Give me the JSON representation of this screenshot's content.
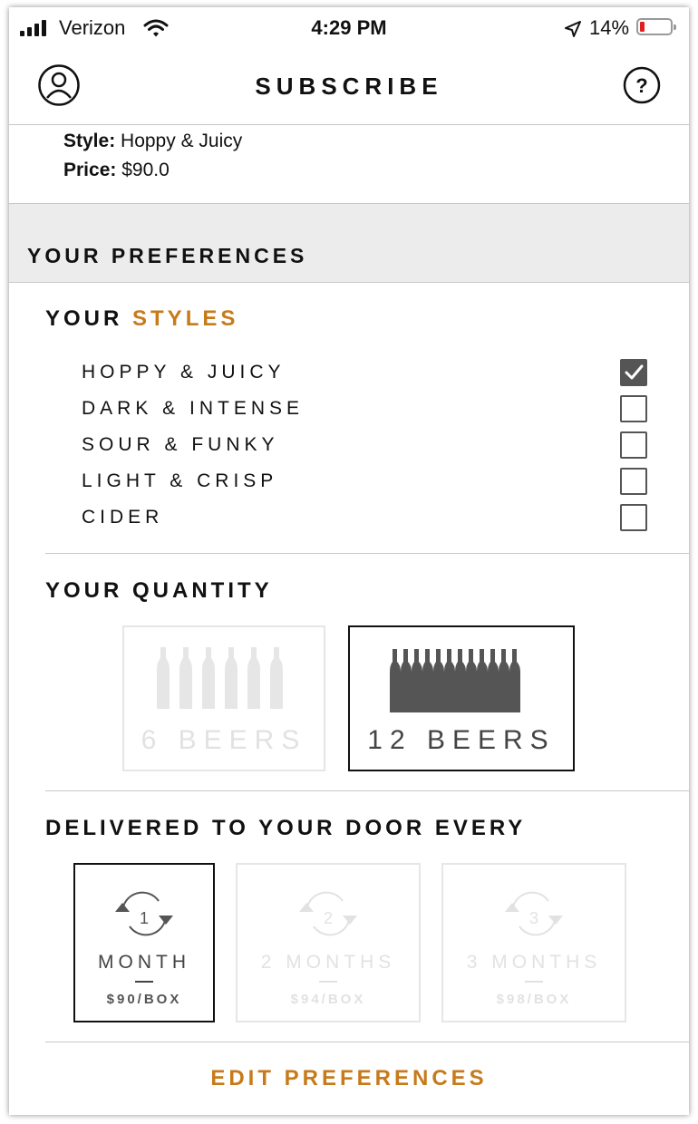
{
  "status_bar": {
    "carrier": "Verizon",
    "time": "4:29 PM",
    "battery_pct": "14%"
  },
  "nav": {
    "title": "SUBSCRIBE",
    "left_icon": "user-icon",
    "right_icon": "help-icon"
  },
  "summary": {
    "style_label": "Style:",
    "style_value": "Hoppy & Juicy",
    "price_label": "Price:",
    "price_value": "$90.0"
  },
  "preferences": {
    "header": "YOUR PREFERENCES",
    "styles_title_a": "YOUR",
    "styles_title_b": "STYLES",
    "styles": [
      {
        "label": "HOPPY & JUICY",
        "checked": true
      },
      {
        "label": "DARK & INTENSE",
        "checked": false
      },
      {
        "label": "SOUR & FUNKY",
        "checked": false
      },
      {
        "label": "LIGHT & CRISP",
        "checked": false
      },
      {
        "label": "CIDER",
        "checked": false
      }
    ],
    "quantity_title": "YOUR QUANTITY",
    "quantities": [
      {
        "label": "6 BEERS",
        "selected": false,
        "bottles": 6
      },
      {
        "label": "12 BEERS",
        "selected": true,
        "bottles": 12
      }
    ],
    "frequency_title": "DELIVERED TO YOUR DOOR EVERY",
    "frequencies": [
      {
        "number": "1",
        "label": "MONTH",
        "price": "$90/BOX",
        "selected": true
      },
      {
        "number": "2",
        "label": "2 MONTHS",
        "price": "$94/BOX",
        "selected": false
      },
      {
        "number": "3",
        "label": "3 MONTHS",
        "price": "$98/BOX",
        "selected": false
      }
    ],
    "edit_label": "EDIT PREFERENCES"
  },
  "colors": {
    "accent": "#c77a1a",
    "selected": "#444444",
    "muted": "#e2e2e2",
    "band": "#ececec"
  }
}
